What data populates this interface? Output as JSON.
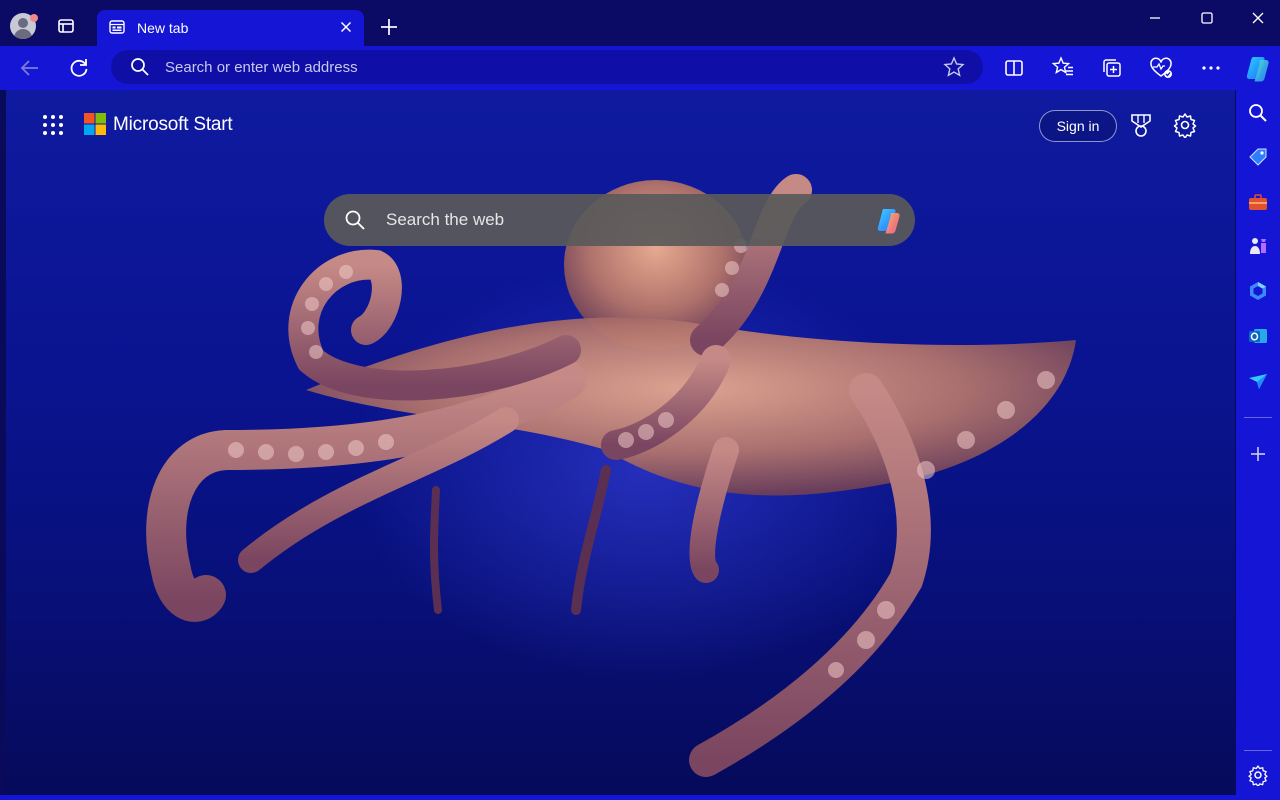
{
  "browser": {
    "tab": {
      "title": "New tab"
    },
    "address_bar": {
      "placeholder": "Search or enter web address"
    }
  },
  "page": {
    "brand": "Microsoft Start",
    "sign_in_label": "Sign in",
    "search": {
      "placeholder": "Search the web"
    }
  },
  "icons": {
    "profile": "profile-avatar",
    "tab_actions": "tab-actions-icon",
    "close_tab": "close-icon",
    "new_tab": "plus-icon",
    "back": "back-arrow-icon",
    "refresh": "refresh-icon",
    "favorite": "star-icon",
    "split_screen": "split-screen-icon",
    "favorites": "favorites-icon",
    "collections": "collections-icon",
    "browser_essentials": "heart-pulse-icon",
    "more": "more-icon",
    "copilot": "copilot-icon"
  },
  "colors": {
    "accent": "#1515d6",
    "titlebar": "#0b0b66",
    "search_bg": "#5a5a5a"
  }
}
